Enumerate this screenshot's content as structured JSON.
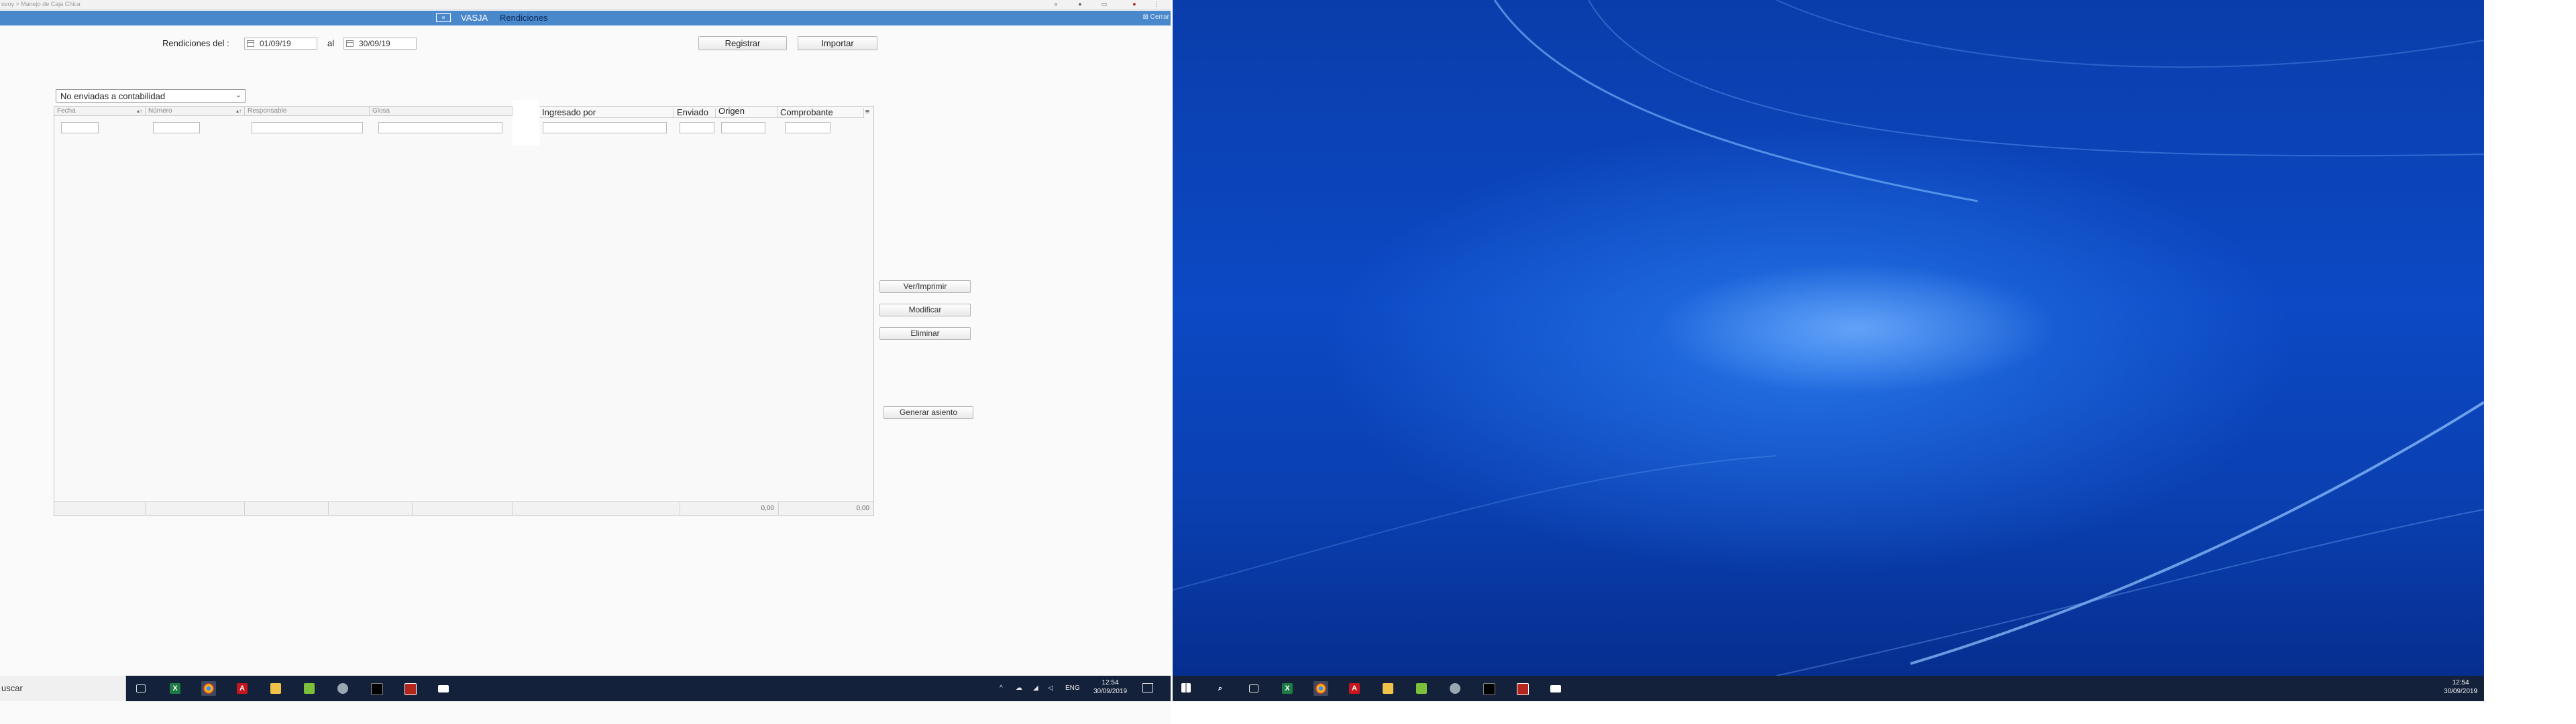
{
  "browser": {
    "url_text": "ovoy > Manejo de Caja Chica"
  },
  "app": {
    "name": "VASJA",
    "module": "Rendiciones",
    "close_label": "Cerrar"
  },
  "filters": {
    "rendiciones_label": "Rendiciones del :",
    "from_date": "01/09/19",
    "to_label": "al",
    "to_date": "30/09/19",
    "register_button": "Registrar",
    "import_button": "Importar",
    "status_selected": "No enviadas a contabilidad"
  },
  "grid": {
    "columns": [
      {
        "label": "Fecha",
        "sortable": true
      },
      {
        "label": "Número",
        "sortable": true
      },
      {
        "label": "Responsable",
        "sortable": false
      },
      {
        "label": "Glosa",
        "sortable": false
      },
      {
        "label": "Ingresado por",
        "sortable": false
      },
      {
        "label": "Enviado",
        "sortable": false
      },
      {
        "label": "Origen",
        "sortable": false
      },
      {
        "label": "Comprobante",
        "sortable": false
      }
    ],
    "footer_totals": [
      "0,00",
      "0,00"
    ],
    "menu_icon": "hamburger-icon"
  },
  "actions": {
    "view_print": "Ver/Imprimir",
    "modify": "Modificar",
    "delete": "Eliminar",
    "generate_entry": "Generar asiento"
  },
  "taskbar_left": {
    "search_text": "uscar",
    "tray_lang": "ENG",
    "time": "12:54",
    "date": "30/09/2019"
  },
  "taskbar_right": {
    "time": "12:54",
    "date": "30/09/2019"
  },
  "icons": {
    "task_view": "task-view-icon",
    "excel": "excel-icon",
    "chrome": "chrome-icon",
    "acrobat": "acrobat-icon",
    "explorer": "file-explorer-icon",
    "notepad": "notepad-icon",
    "snip": "snipping-tool-icon",
    "terminal": "terminal-icon",
    "app_red": "red-app-icon",
    "window": "window-icon"
  },
  "colors": {
    "app_bar": "#4a88cc",
    "taskbar": "#14213a",
    "desktop": "#0c49c4"
  }
}
